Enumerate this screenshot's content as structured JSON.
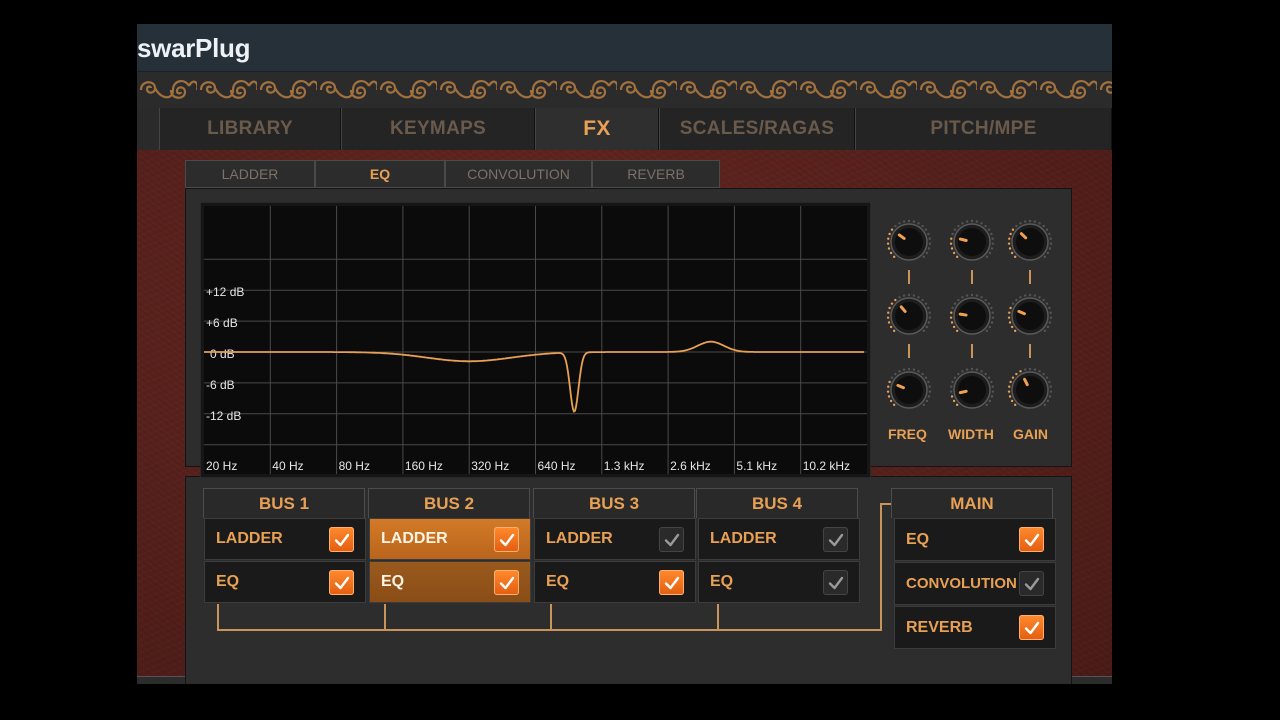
{
  "window": {
    "title": "swarPlug"
  },
  "tabs": [
    {
      "label": "LIBRARY",
      "active": false
    },
    {
      "label": "KEYMAPS",
      "active": false
    },
    {
      "label": "FX",
      "active": true
    },
    {
      "label": "SCALES/RAGAS",
      "active": false
    },
    {
      "label": "PITCH/MPE",
      "active": false
    }
  ],
  "subtabs": [
    {
      "label": "LADDER",
      "active": false
    },
    {
      "label": "EQ",
      "active": true
    },
    {
      "label": "CONVOLUTION",
      "active": false
    },
    {
      "label": "REVERB",
      "active": false
    }
  ],
  "eq_graph": {
    "db_labels": [
      "+12 dB",
      "+6 dB",
      "0 dB",
      "-6 dB",
      "-12 dB"
    ],
    "freq_labels": [
      "20 Hz",
      "40 Hz",
      "80 Hz",
      "160 Hz",
      "320 Hz",
      "640 Hz",
      "1.3 kHz",
      "2.6 kHz",
      "5.1 kHz",
      "10.2 kHz"
    ],
    "curve_color": "#e8a055",
    "bands": [
      {
        "freq_hz": 320,
        "gain_db": -1.8
      },
      {
        "freq_hz": 960,
        "gain_db": -11.5
      },
      {
        "freq_hz": 4000,
        "gain_db": 2.0
      }
    ]
  },
  "knobs": {
    "labels": [
      "FREQ",
      "WIDTH",
      "GAIN"
    ],
    "rows": [
      [
        {
          "value": 0.3
        },
        {
          "value": 0.22
        },
        {
          "value": 0.33
        }
      ],
      [
        {
          "value": 0.35
        },
        {
          "value": 0.2
        },
        {
          "value": 0.25
        }
      ],
      [
        {
          "value": 0.25
        },
        {
          "value": 0.12
        },
        {
          "value": 0.4
        }
      ]
    ]
  },
  "routing": {
    "buses": [
      {
        "name": "BUS 1",
        "fx": [
          {
            "label": "LADDER",
            "enabled": true
          },
          {
            "label": "EQ",
            "enabled": true
          }
        ]
      },
      {
        "name": "BUS 2",
        "selected": true,
        "fx": [
          {
            "label": "LADDER",
            "enabled": true
          },
          {
            "label": "EQ",
            "enabled": true
          }
        ]
      },
      {
        "name": "BUS 3",
        "fx": [
          {
            "label": "LADDER",
            "enabled": false
          },
          {
            "label": "EQ",
            "enabled": true
          }
        ]
      },
      {
        "name": "BUS 4",
        "fx": [
          {
            "label": "LADDER",
            "enabled": false
          },
          {
            "label": "EQ",
            "enabled": false
          }
        ]
      }
    ],
    "main": {
      "name": "MAIN",
      "fx": [
        {
          "label": "EQ",
          "enabled": true
        },
        {
          "label": "CONVOLUTION",
          "enabled": false
        },
        {
          "label": "REVERB",
          "enabled": true
        }
      ]
    }
  },
  "colors": {
    "accent": "#e8a055",
    "accent_on": "#f07a20",
    "panel": "#2d2d2d",
    "background": "#5a221d"
  }
}
